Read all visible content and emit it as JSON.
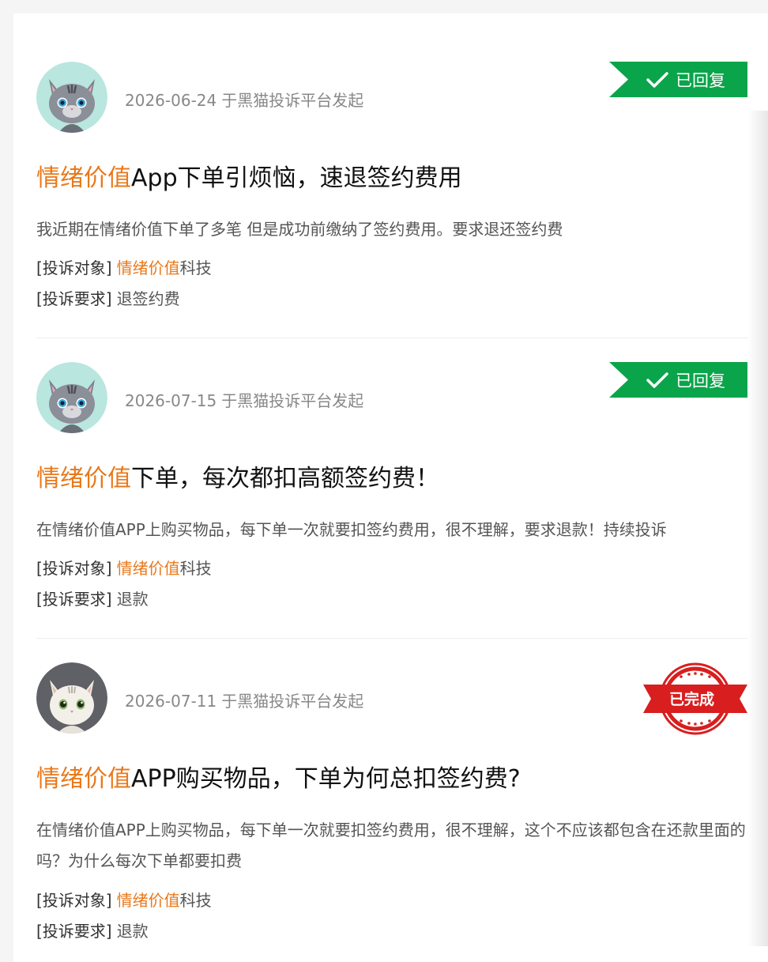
{
  "labels": {
    "target": "[投诉对象]",
    "request": "[投诉要求]",
    "platform_suffix": "于黑猫投诉平台发起"
  },
  "complaints": [
    {
      "date": "2026-06-24",
      "status": "已回复",
      "status_type": "replied",
      "title_highlight": "情绪价值",
      "title_rest": "App下单引烦恼，速退签约费用",
      "description": "我近期在情绪价值下单了多笔 但是成功前缴纳了签约费用。要求退还签约费",
      "target_highlight": "情绪价值",
      "target_rest": "科技",
      "request": "退签约费",
      "avatar": "gray-tabby-cat-avatar"
    },
    {
      "date": "2026-07-15",
      "status": "已回复",
      "status_type": "replied",
      "title_highlight": "情绪价值",
      "title_rest": "下单，每次都扣高额签约费！",
      "description": "在情绪价值APP上购买物品，每下单一次就要扣签约费用，很不理解，要求退款！持续投诉",
      "target_highlight": "情绪价值",
      "target_rest": "科技",
      "request": "退款",
      "avatar": "gray-tabby-cat-avatar"
    },
    {
      "date": "2026-07-11",
      "status": "已完成",
      "status_type": "completed",
      "title_highlight": "情绪价值",
      "title_rest": "APP购买物品，下单为何总扣签约费?",
      "description": "在情绪价值APP上购买物品，每下单一次就要扣签约费用，很不理解，这个不应该都包含在还款里面的吗？为什么每次下单都要扣费",
      "target_highlight": "情绪价值",
      "target_rest": "科技",
      "request": "退款",
      "avatar": "white-cat-avatar"
    }
  ],
  "colors": {
    "highlight": "#e9781a",
    "replied_badge": "#0aa54a",
    "completed_badge": "#d81e1e",
    "meta_text": "#888888"
  }
}
